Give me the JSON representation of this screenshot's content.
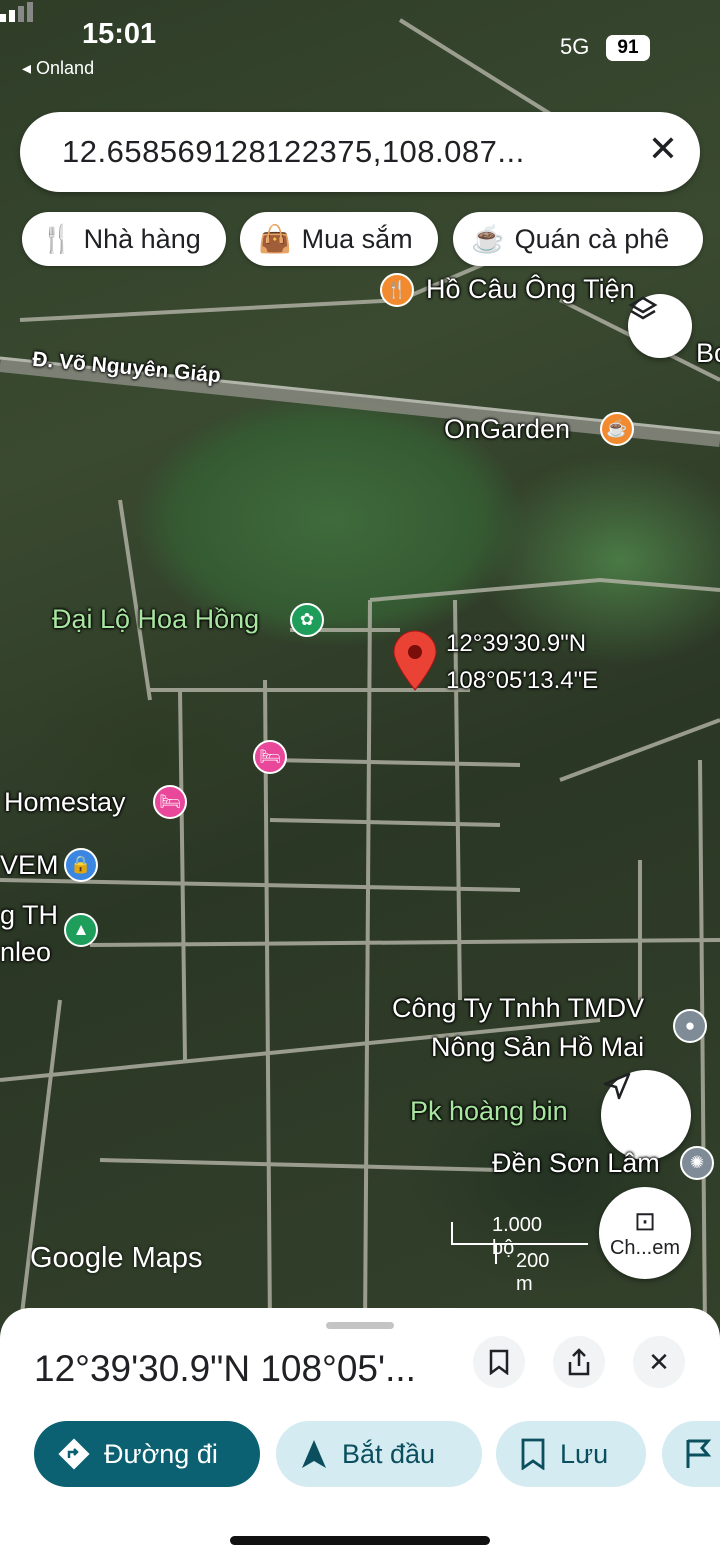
{
  "status_bar": {
    "time": "15:01",
    "back_app": "◂ Onland",
    "network": "5G",
    "battery": "91"
  },
  "search": {
    "query": "12.658569128122375,108.087...",
    "close_icon": "close-icon"
  },
  "chips": [
    {
      "label": "Nhà hàng",
      "icon": "restaurant-icon"
    },
    {
      "label": "Mua sắm",
      "icon": "shopping-bag-icon"
    },
    {
      "label": "Quán cà phê",
      "icon": "coffee-icon"
    }
  ],
  "map": {
    "road_label": "Đ. Võ Nguyên Giáp",
    "pins": {
      "ho_cau": "Hồ Câu Ông Tiện",
      "edge_b": "Bo",
      "ongarden": "OnGarden",
      "dai_lo": "Đại Lộ Hoa Hồng",
      "homestay": "Homestay",
      "vem": "VEM",
      "th_line1": "g TH",
      "th_line2": "nleo",
      "cong_ty_line1": "Công Ty Tnhh TMDV",
      "cong_ty_line2": "Nông Sản Hồ Mai",
      "pk": "Pk hoàng bin",
      "den": "Đền Sơn Lâm"
    },
    "dropped_pin": {
      "lat": "12°39'30.9\"N",
      "lon": "108°05'13.4\"E"
    },
    "scale": {
      "imperial": "1.000 bộ",
      "metric": "200 m"
    },
    "logo": "Google Maps",
    "camera_label": "Ch...em"
  },
  "sheet": {
    "title": "12°39'30.9\"N 108°05'...",
    "actions": [
      {
        "label": "Đường đi",
        "icon": "directions-icon"
      },
      {
        "label": "Bắt đầu",
        "icon": "navigation-arrow-icon"
      },
      {
        "label": "Lưu",
        "icon": "bookmark-icon"
      }
    ]
  },
  "colors": {
    "primary": "#0b6171",
    "secondary_bg": "#d3ebf1",
    "pin_red": "#ea4335"
  }
}
